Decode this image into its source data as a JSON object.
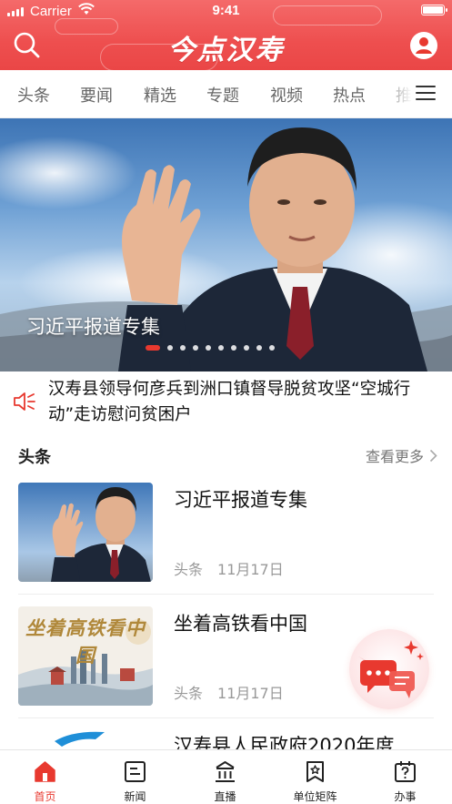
{
  "status_bar": {
    "carrier": "Carrier",
    "time": "9:41"
  },
  "header": {
    "title": "今点汉寿"
  },
  "tabs": [
    {
      "label": "头条"
    },
    {
      "label": "要闻"
    },
    {
      "label": "精选"
    },
    {
      "label": "专题"
    },
    {
      "label": "视频"
    },
    {
      "label": "热点"
    },
    {
      "label": "推"
    }
  ],
  "banner": {
    "caption": "习近平报道专集",
    "slide_count": 10,
    "active_slide": 0
  },
  "notice": {
    "text": "汉寿县领导何彦兵到洲口镇督导脱贫攻坚“空城行动”走访慰问贫困户"
  },
  "section": {
    "title": "头条",
    "more_label": "查看更多"
  },
  "news": [
    {
      "title": "习近平报道专集",
      "category": "头条",
      "date": "11月17日"
    },
    {
      "title": "坐着高铁看中国",
      "category": "头条",
      "date": "11月17日",
      "thumb_text": "坐着高铁看中国"
    },
    {
      "title": "汉寿县人民政府2020年度"
    }
  ],
  "bottom_nav": [
    {
      "label": "首页",
      "icon": "home-icon",
      "active": true
    },
    {
      "label": "新闻",
      "icon": "news-icon"
    },
    {
      "label": "直播",
      "icon": "live-icon"
    },
    {
      "label": "单位矩阵",
      "icon": "bookmark-star-icon"
    },
    {
      "label": "办事",
      "icon": "calendar-question-icon"
    }
  ],
  "colors": {
    "brand": "#e8392f",
    "header": "#ee4f4f"
  }
}
